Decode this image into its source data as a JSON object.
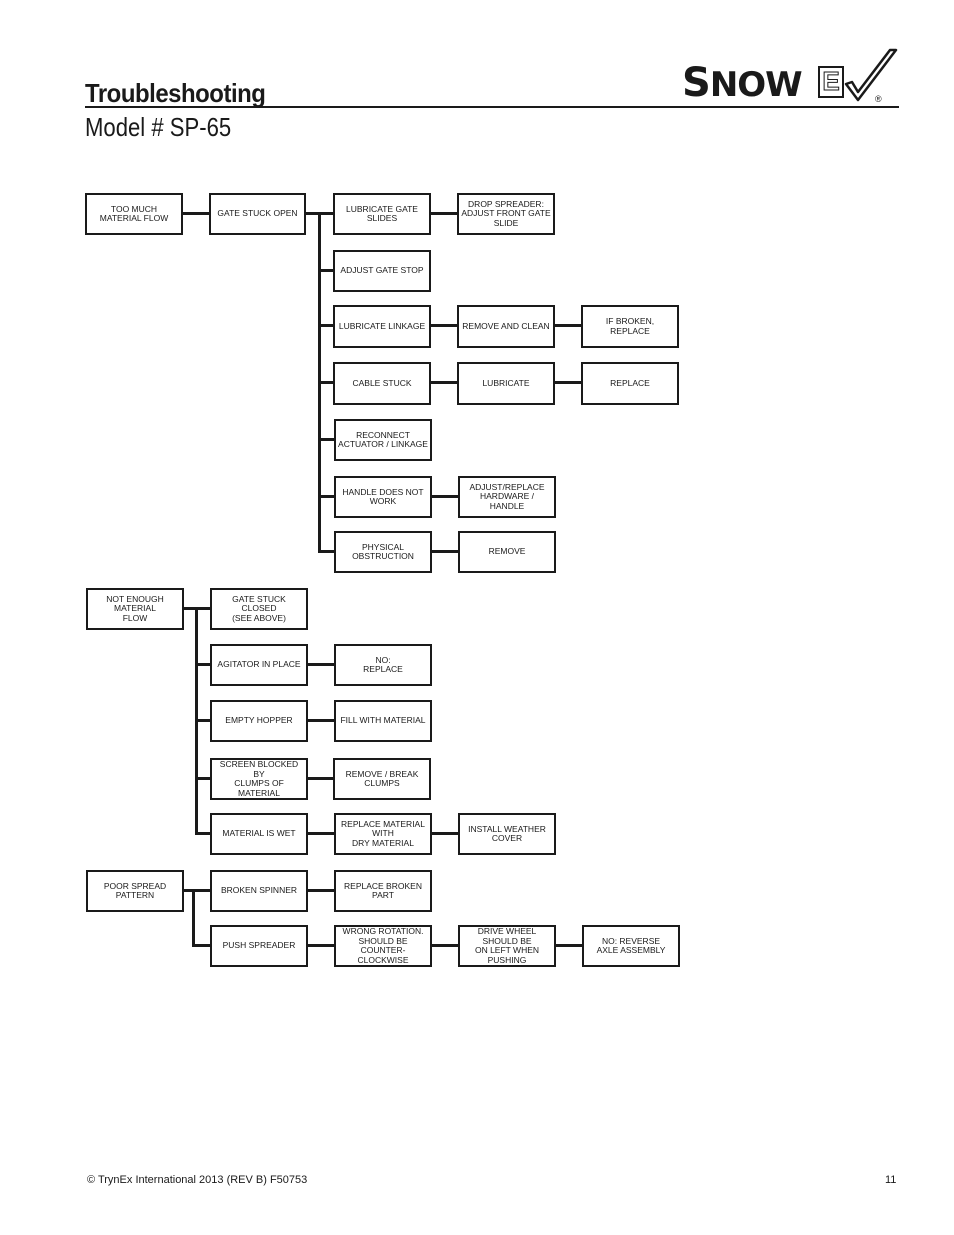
{
  "header": {
    "title": "Troubleshooting",
    "subtitle": "Model # SP-65",
    "logo": {
      "text": "SnowEx",
      "registered": "®"
    }
  },
  "flowchart": {
    "too_much": {
      "root": "TOO MUCH\nMATERIAL FLOW",
      "cause": "GATE STUCK OPEN",
      "lubricate_gate_slides": "LUBRICATE GATE SLIDES",
      "drop_spreader": "DROP SPREADER:\nADJUST FRONT GATE\nSLIDE",
      "adjust_gate_stop": "ADJUST GATE STOP",
      "lubricate_linkage": "LUBRICATE LINKAGE",
      "remove_and_clean": "REMOVE AND CLEAN",
      "if_broken_replace": "IF BROKEN, REPLACE",
      "cable_stuck": "CABLE STUCK",
      "lubricate": "LUBRICATE",
      "replace": "REPLACE",
      "reconnect": "RECONNECT\nACTUATOR / LINKAGE",
      "handle": "HANDLE DOES NOT WORK",
      "adjust_replace_hw": "ADJUST/REPLACE\nHARDWARE / HANDLE",
      "obstruction": "PHYSICAL OBSTRUCTION",
      "remove": "REMOVE"
    },
    "not_enough": {
      "root": "NOT ENOUGH MATERIAL\nFLOW",
      "gate_closed": "GATE STUCK CLOSED\n(SEE ABOVE)",
      "agitator": "AGITATOR IN PLACE",
      "no_replace": "NO:\nREPLACE",
      "empty_hopper": "EMPTY HOPPER",
      "fill": "FILL WITH MATERIAL",
      "screen_blocked": "SCREEN BLOCKED BY\nCLUMPS OF MATERIAL",
      "remove_clumps": "REMOVE / BREAK CLUMPS",
      "wet": "MATERIAL IS WET",
      "replace_dry": "REPLACE MATERIAL WITH\nDRY MATERIAL",
      "weather_cover": "INSTALL WEATHER COVER"
    },
    "poor_spread": {
      "root": "POOR SPREAD PATTERN",
      "broken_spinner": "BROKEN SPINNER",
      "replace_part": "REPLACE BROKEN PART",
      "push_spreader": "PUSH SPREADER",
      "wrong_rotation": "WRONG ROTATION.\nSHOULD BE\nCOUNTER-CLOCKWISE",
      "drive_wheel": "DRIVE WHEEL SHOULD BE\nON LEFT WHEN PUSHING",
      "reverse_axle": "NO: REVERSE\nAXLE ASSEMBLY"
    }
  },
  "footer": {
    "copyright": "© TrynEx International 2013 (REV B) F50753",
    "page_number": "11"
  }
}
